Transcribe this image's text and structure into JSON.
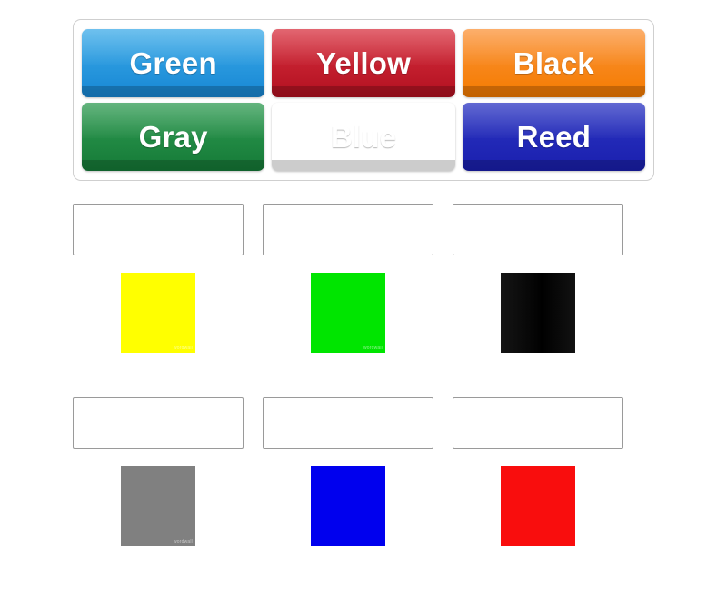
{
  "tray": {
    "tiles": [
      {
        "label": "Green",
        "fill_top": "#3cabe8",
        "fill_bottom": "#1787d4",
        "name": "tile-green"
      },
      {
        "label": "Yellow",
        "fill_top": "#d8313f",
        "fill_bottom": "#b21020",
        "name": "tile-yellow"
      },
      {
        "label": "Black",
        "fill_top": "#fb9338",
        "fill_bottom": "#f47b00",
        "name": "tile-black"
      },
      {
        "label": "Gray",
        "fill_top": "#2f9b52",
        "fill_bottom": "#157a37",
        "name": "tile-gray"
      },
      {
        "label": "Blue",
        "fill_top": "#d israeli",
        "fill_bottom": "#c83ad8",
        "name": "tile-blue"
      },
      {
        "label": "Reed",
        "fill_top": "#2b35c2",
        "fill_bottom": "#1a1fae",
        "name": "tile-reed"
      }
    ]
  },
  "answers": {
    "rows": [
      [
        {
          "dropzone_value": "",
          "dropzone_placeholder": "",
          "swatch_color": "#ffff00",
          "swatch_name": "swatch-yellow",
          "swatch_mark": "wordwall",
          "dark": false
        },
        {
          "dropzone_value": "",
          "dropzone_placeholder": "",
          "swatch_color": "#00e500",
          "swatch_name": "swatch-green",
          "swatch_mark": "wordwall",
          "dark": false
        },
        {
          "dropzone_value": "",
          "dropzone_placeholder": "",
          "swatch_color": "#0a0a0a",
          "swatch_name": "swatch-black",
          "swatch_mark": "",
          "dark": true
        }
      ],
      [
        {
          "dropzone_value": "",
          "dropzone_placeholder": "",
          "swatch_color": "#808080",
          "swatch_name": "swatch-gray",
          "swatch_mark": "wordwall",
          "dark": false
        },
        {
          "dropzone_value": "",
          "dropzone_placeholder": "",
          "swatch_color": "#0000ee",
          "swatch_name": "swatch-blue",
          "swatch_mark": "",
          "dark": true
        },
        {
          "dropzone_value": "",
          "dropzone_placeholder": "",
          "swatch_color": "#f90d0d",
          "swatch_name": "swatch-red",
          "swatch_mark": "",
          "dark": true
        }
      ]
    ]
  }
}
